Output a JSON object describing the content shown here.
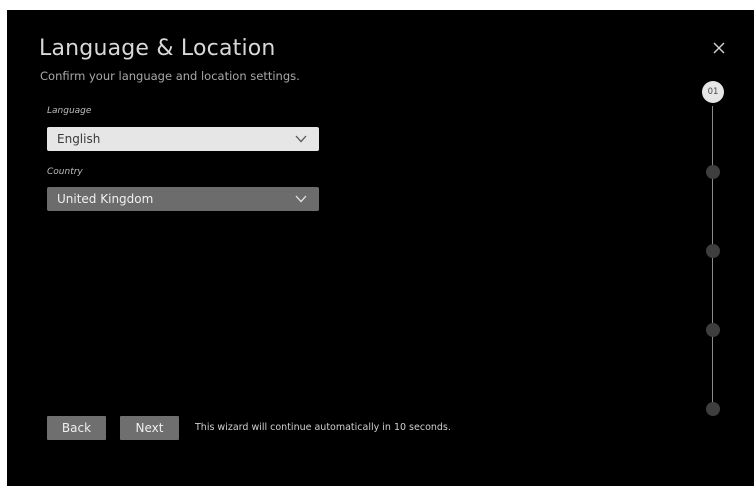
{
  "wizard": {
    "title": "Language & Location",
    "subtitle": "Confirm your language and location settings.",
    "close_icon": "close-icon"
  },
  "language": {
    "label": "Language",
    "value": "English",
    "icon": "chevron-down-icon"
  },
  "country": {
    "label": "Country",
    "value": "United Kingdom",
    "icon": "chevron-down-icon"
  },
  "footer": {
    "back_label": "Back",
    "next_label": "Next",
    "auto_message": "This wizard will continue automatically in 10 seconds."
  },
  "stepper": {
    "current_step": "01",
    "total_steps": 5
  },
  "colors": {
    "background": "#000000",
    "select_light": "#e6e6e6",
    "select_focused": "#6c6c6c",
    "button": "#6f6f6f"
  }
}
